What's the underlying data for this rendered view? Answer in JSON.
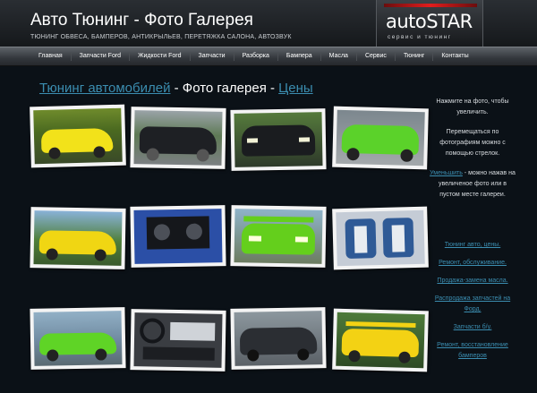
{
  "header": {
    "title_main": "Авто Тюнинг",
    "title_dash": " - ",
    "title_accent": "Фото Галерея",
    "subtitle": "ТЮНИНГ ОБВЕСА, БАМПЕРОВ, АНТИКРЫЛЬЕВ, ПЕРЕТЯЖКА САЛОНА, АВТОЗВУК",
    "logo_text": "autoSTAR",
    "logo_sub": "сервис и тюнинг"
  },
  "nav": {
    "items": [
      "Главная",
      "Запчасти Ford",
      "Жидкости Ford",
      "Запчасти",
      "Разборка",
      "Бампера",
      "Масла",
      "Сервис",
      "Тюнинг",
      "Контакты"
    ]
  },
  "heading": {
    "link1": "Тюнинг автомобилей",
    "middle": " - Фото галерея - ",
    "link2": "Цены"
  },
  "sidebar": {
    "p1": "Нажмите на фото, чтобы увеличить.",
    "p2": "Перемещаться по фотографиям можно с помощью стрелок.",
    "p3_link": "Уменьшить",
    "p3_rest": " - можно нажав на увеличеное фото или в пустом месте галереи.",
    "links": [
      "Тюнинг авто, цены.",
      "Ремонт, обслуживание.",
      "Продажа-замена масла.",
      "Распродажа запчастей на Форд.",
      "Запчасти б/у.",
      "Ремонт, восстановление бамперов"
    ]
  },
  "gallery": {
    "photos": [
      {
        "icon": "yellow-car-photo-icon",
        "color": "#f2e21a"
      },
      {
        "icon": "black-car-photo-icon",
        "color": "#1e2024"
      },
      {
        "icon": "black-car-headlights-photo-icon",
        "color": "#1a1c1f"
      },
      {
        "icon": "green-car-photo-icon",
        "color": "#5bd22a"
      },
      {
        "icon": "yellow-car-photo-icon",
        "color": "#f0d613"
      },
      {
        "icon": "trunk-speakers-photo-icon",
        "color": "#2b4fa6"
      },
      {
        "icon": "green-car-spoiler-photo-icon",
        "color": "#64cf1c"
      },
      {
        "icon": "car-interior-seats-photo-icon",
        "color": "#c5ccd6"
      },
      {
        "icon": "green-convertible-photo-icon",
        "color": "#5fd426"
      },
      {
        "icon": "dashboard-photo-icon",
        "color": "#3a3d42"
      },
      {
        "icon": "dark-car-photo-icon",
        "color": "#2b2e33"
      },
      {
        "icon": "yellow-car-rear-photo-icon",
        "color": "#f3d214"
      }
    ]
  }
}
